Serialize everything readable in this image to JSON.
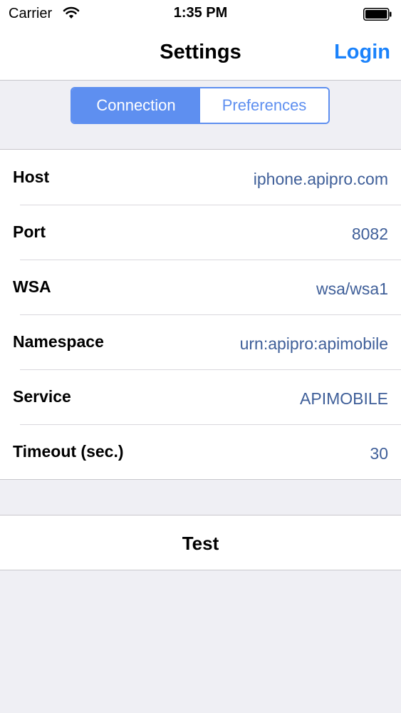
{
  "status_bar": {
    "carrier": "Carrier",
    "time": "1:35 PM",
    "wifi_icon": "wifi-icon",
    "battery_icon": "battery-icon"
  },
  "nav": {
    "title": "Settings",
    "right_button": "Login",
    "accent_color": "#1a82fb"
  },
  "segments": {
    "items": [
      {
        "label": "Connection",
        "selected": true
      },
      {
        "label": "Preferences",
        "selected": false
      }
    ],
    "tint_color": "#5e8ff0"
  },
  "rows": [
    {
      "label": "Host",
      "value": "iphone.apipro.com"
    },
    {
      "label": "Port",
      "value": "8082"
    },
    {
      "label": "WSA",
      "value": "wsa/wsa1"
    },
    {
      "label": "Namespace",
      "value": "urn:apipro:apimobile"
    },
    {
      "label": "Service",
      "value": "APIMOBILE"
    },
    {
      "label": "Timeout (sec.)",
      "value": "30"
    }
  ],
  "test_button": "Test",
  "value_color": "#3f5f99"
}
